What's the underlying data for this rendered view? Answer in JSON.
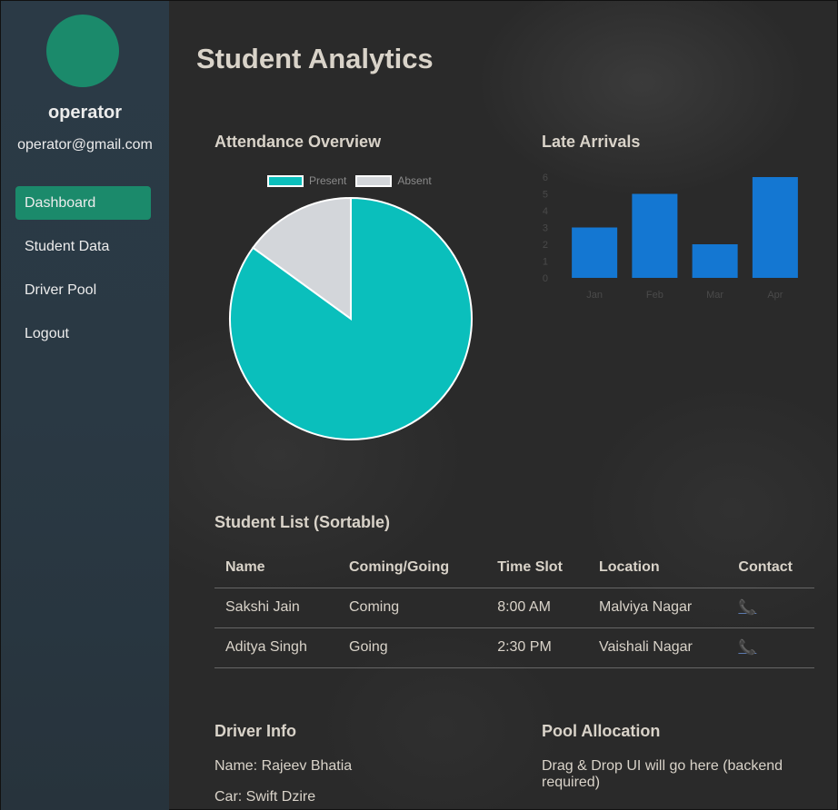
{
  "sidebar": {
    "user_name": "operator",
    "user_email": "operator@gmail.com",
    "items": [
      {
        "label": "Dashboard",
        "active": true
      },
      {
        "label": "Student Data",
        "active": false
      },
      {
        "label": "Driver Pool",
        "active": false
      },
      {
        "label": "Logout",
        "active": false
      }
    ]
  },
  "page": {
    "title": "Student Analytics"
  },
  "attendance": {
    "title": "Attendance Overview"
  },
  "late": {
    "title": "Late Arrivals"
  },
  "chart_data": [
    {
      "type": "pie",
      "labels": [
        "Present",
        "Absent"
      ],
      "values": [
        85,
        15
      ],
      "colors": [
        "#0abfbc",
        "#d3d6da"
      ],
      "legend": "top"
    },
    {
      "type": "bar",
      "categories": [
        "Jan",
        "Feb",
        "Mar",
        "Apr"
      ],
      "values": [
        3,
        5,
        2,
        6
      ],
      "ylim": [
        0,
        6
      ],
      "yticks": [
        "0",
        "1",
        "2",
        "3",
        "4",
        "5",
        "6"
      ],
      "color": "#1477d2",
      "legend": "none"
    }
  ],
  "student_list": {
    "title": "Student List (Sortable)",
    "columns": [
      "Name",
      "Coming/Going",
      "Time Slot",
      "Location",
      "Contact"
    ],
    "rows": [
      [
        "Sakshi Jain",
        "Coming",
        "8:00 AM",
        "Malviya Nagar",
        "📞"
      ],
      [
        "Aditya Singh",
        "Going",
        "2:30 PM",
        "Vaishali Nagar",
        "📞"
      ]
    ]
  },
  "driver_info": {
    "title": "Driver Info",
    "name_line": "Name: Rajeev Bhatia",
    "car_line": "Car: Swift Dzire"
  },
  "pool_allocation": {
    "title": "Pool Allocation",
    "text": "Drag & Drop UI will go here (backend required)"
  },
  "colors": {
    "accent": "#1b8a6b",
    "sidebar": "#2b3a46"
  }
}
